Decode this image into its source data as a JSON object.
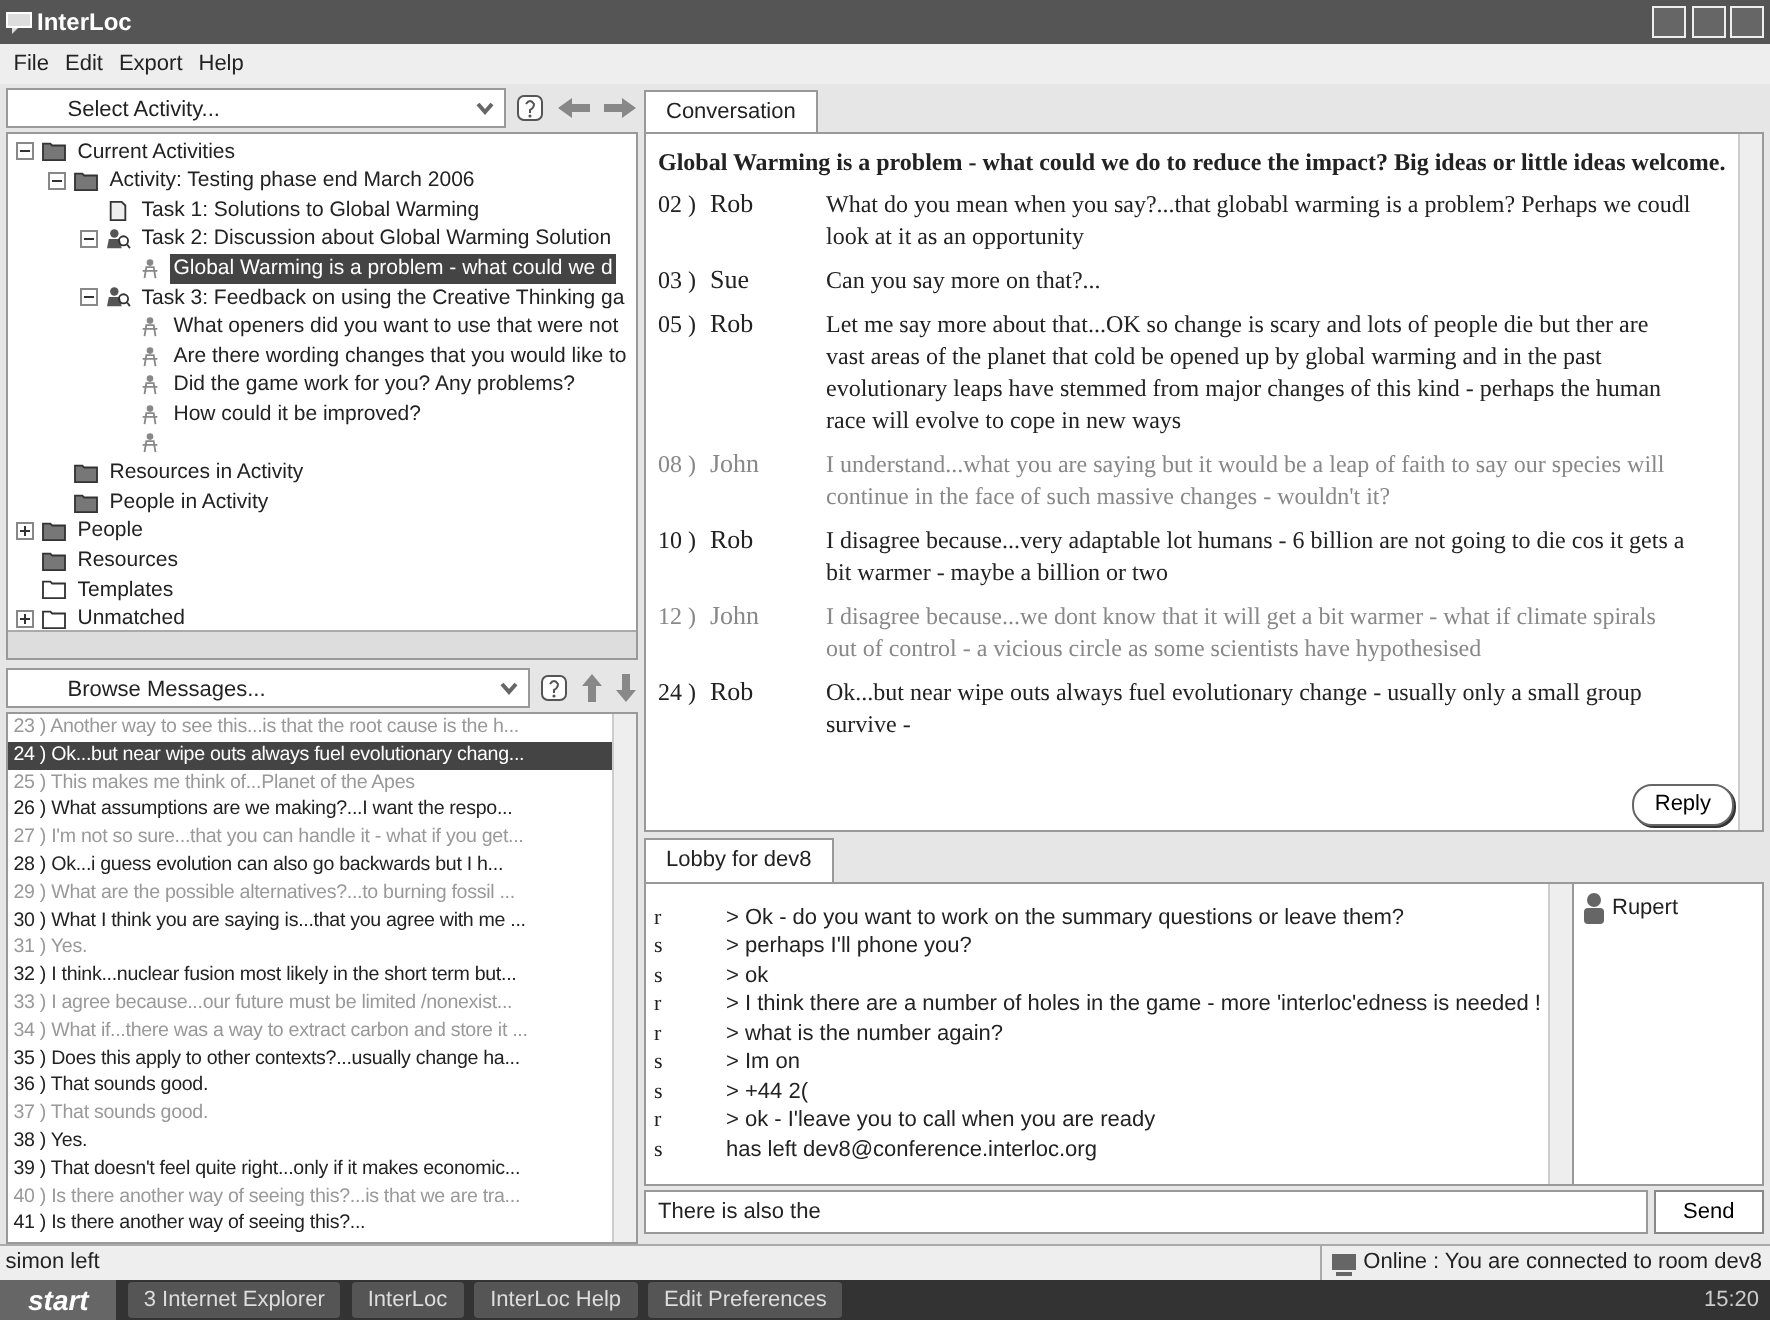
{
  "window": {
    "title": "InterLoc"
  },
  "menu": [
    "File",
    "Edit",
    "Export",
    "Help"
  ],
  "activity_selector": {
    "value": "Select Activity..."
  },
  "tree": [
    {
      "label": "Current Activities",
      "kind": "folder",
      "expanded": true,
      "selected": false,
      "children": [
        {
          "label": "Activity: Testing phase end March 2006",
          "kind": "folder",
          "expanded": true,
          "selected": false,
          "children": [
            {
              "label": "Task 1: Solutions to Global Warming",
              "kind": "document",
              "selected": false
            },
            {
              "label": "Task 2: Discussion about Global Warming Solution",
              "kind": "task",
              "expanded": true,
              "selected": false,
              "children": [
                {
                  "label": "Global Warming is a problem - what could we d",
                  "kind": "question",
                  "selected": true
                }
              ]
            },
            {
              "label": "Task 3: Feedback on using the Creative Thinking ga",
              "kind": "task",
              "expanded": true,
              "selected": false,
              "children": [
                {
                  "label": "What openers did you want to use that were not",
                  "kind": "question",
                  "selected": false
                },
                {
                  "label": "Are there wording changes that you would like to",
                  "kind": "question",
                  "selected": false
                },
                {
                  "label": "Did the game work for you? Any problems?",
                  "kind": "question",
                  "selected": false
                },
                {
                  "label": "How could it be improved?",
                  "kind": "question",
                  "selected": false
                },
                {
                  "kind": "question",
                  "selected": false
                }
              ]
            }
          ]
        },
        {
          "label": "Resources in Activity",
          "kind": "folder",
          "selected": false
        },
        {
          "label": "People in Activity",
          "kind": "folder",
          "selected": false
        }
      ]
    },
    {
      "label": "People",
      "kind": "folder",
      "expanded": false,
      "selected": false
    },
    {
      "label": "Resources",
      "kind": "folder",
      "selected": false
    },
    {
      "label": "Templates",
      "kind": "empty-folder",
      "selected": false
    },
    {
      "label": "Unmatched",
      "kind": "empty-folder",
      "expanded": false,
      "selected": false
    }
  ],
  "message_browser": {
    "value": "Browse Messages..."
  },
  "messages": [
    {
      "number": "23 )",
      "text": "Another way to see this...is that the root cause is the h...",
      "read": true,
      "selected": false
    },
    {
      "number": "24 )",
      "text": "Ok...but near wipe outs always fuel evolutionary chang...",
      "read": false,
      "selected": true
    },
    {
      "number": "25 )",
      "text": "This makes me think of...Planet of the Apes",
      "read": true,
      "selected": false
    },
    {
      "number": "26 )",
      "text": "What assumptions are we making?...I want the respo...",
      "read": false,
      "selected": false
    },
    {
      "number": "27 )",
      "text": "I'm not so sure...that you can handle it - what if you get...",
      "read": true,
      "selected": false
    },
    {
      "number": "28 )",
      "text": "Ok...i guess evolution can also go backwards but I h...",
      "read": false,
      "selected": false
    },
    {
      "number": "29 )",
      "text": "What are the possible alternatives?...to burning fossil ...",
      "read": true,
      "selected": false
    },
    {
      "number": "30 )",
      "text": "What I think you are saying is...that you agree with me ...",
      "read": false,
      "selected": false
    },
    {
      "number": "31 )",
      "text": "Yes.",
      "read": true,
      "selected": false
    },
    {
      "number": "32 )",
      "text": "I think...nuclear fusion most likely in the short term but...",
      "read": false,
      "selected": false
    },
    {
      "number": "33 )",
      "text": "I agree because...our future must be limited /nonexist...",
      "read": true,
      "selected": false
    },
    {
      "number": "34 )",
      "text": "What if...there was a way to extract carbon and store it ...",
      "read": true,
      "selected": false
    },
    {
      "number": "35 )",
      "text": "Does this apply to other contexts?...usually change ha...",
      "read": false,
      "selected": false
    },
    {
      "number": "36 )",
      "text": "That sounds good.",
      "read": false,
      "selected": false
    },
    {
      "number": "37 )",
      "text": "That sounds good.",
      "read": true,
      "selected": false
    },
    {
      "number": "38 )",
      "text": "Yes.",
      "read": false,
      "selected": false
    },
    {
      "number": "39 )",
      "text": "That doesn't feel quite right...only if it makes economic...",
      "read": false,
      "selected": false
    },
    {
      "number": "40 )",
      "text": "Is there another way of seeing this?...is that we are tra...",
      "read": true,
      "selected": false
    },
    {
      "number": "41 )",
      "text": "Is there another way of seeing this?...",
      "read": false,
      "selected": false
    }
  ],
  "left_status": "simon  left",
  "conversation": {
    "tab": "Conversation",
    "topic": "Global Warming is a problem - what could we do to reduce the impact? Big ideas or little ideas welcome.",
    "posts": [
      {
        "number": "02 )",
        "author": "Rob",
        "text": "What do you mean when you say?...that globabl warming is a problem? Perhaps we coudl look at it as an opportunity",
        "read": false
      },
      {
        "number": "03 )",
        "author": "Sue",
        "text": "Can you say more on that?...",
        "read": false
      },
      {
        "number": "05 )",
        "author": "Rob",
        "text": "Let me say more about that...OK so change is scary and lots of people die but ther are vast areas of the planet that cold be opened up by global warming and in the past evolutionary leaps have stemmed from major changes of this kind - perhaps the human race will evolve to cope in new ways",
        "read": false
      },
      {
        "number": "08 )",
        "author": "John",
        "text": "I understand...what you are saying but it would be a leap of faith to say our species will continue in the face of such massive changes - wouldn't it?",
        "read": true
      },
      {
        "number": "10 )",
        "author": "Rob",
        "text": "I disagree because...very adaptable lot humans - 6 billion are not going to die cos it gets a bit warmer - maybe a billion or two",
        "read": false
      },
      {
        "number": "12 )",
        "author": "John",
        "text": "I disagree because...we dont know that it will get a bit warmer - what if climate spirals out of control - a vicious circle as some scientists have hypothesised",
        "read": true
      },
      {
        "number": "24 )",
        "author": "Rob",
        "text": "Ok...but near wipe outs always fuel evolutionary change - usually only a small group survive -",
        "read": false
      }
    ],
    "reply_button": "Reply"
  },
  "lobby": {
    "tab": "Lobby for dev8",
    "lines": [
      {
        "sender": "r",
        "text": "> Ok - do you want to work on the summary questions or leave them?"
      },
      {
        "sender": "s",
        "text": "> perhaps I'll phone you?"
      },
      {
        "sender": "s",
        "text": "> ok"
      },
      {
        "sender": "r",
        "text": "> I think there are a number of holes in the game - more 'interloc'edness is needed !"
      },
      {
        "sender": "r",
        "text": "> what is the number again?"
      },
      {
        "sender": "s",
        "text": "> Im on"
      },
      {
        "sender": "s",
        "text": "> +44 2("
      },
      {
        "sender": "r",
        "text": "> ok - I'leave you to call when you are ready"
      },
      {
        "sender": "s",
        "text": "has left dev8@conference.interloc.org"
      }
    ],
    "participants": [
      "Rupert"
    ],
    "input": {
      "value": "There is also the"
    },
    "send_button": "Send"
  },
  "status": "Online  : You are connected to room dev8",
  "taskbar": {
    "start": "start",
    "buttons": [
      "3 Internet Explorer",
      "InterLoc",
      "InterLoc Help",
      "Edit Preferences"
    ],
    "clock": "15:20"
  }
}
